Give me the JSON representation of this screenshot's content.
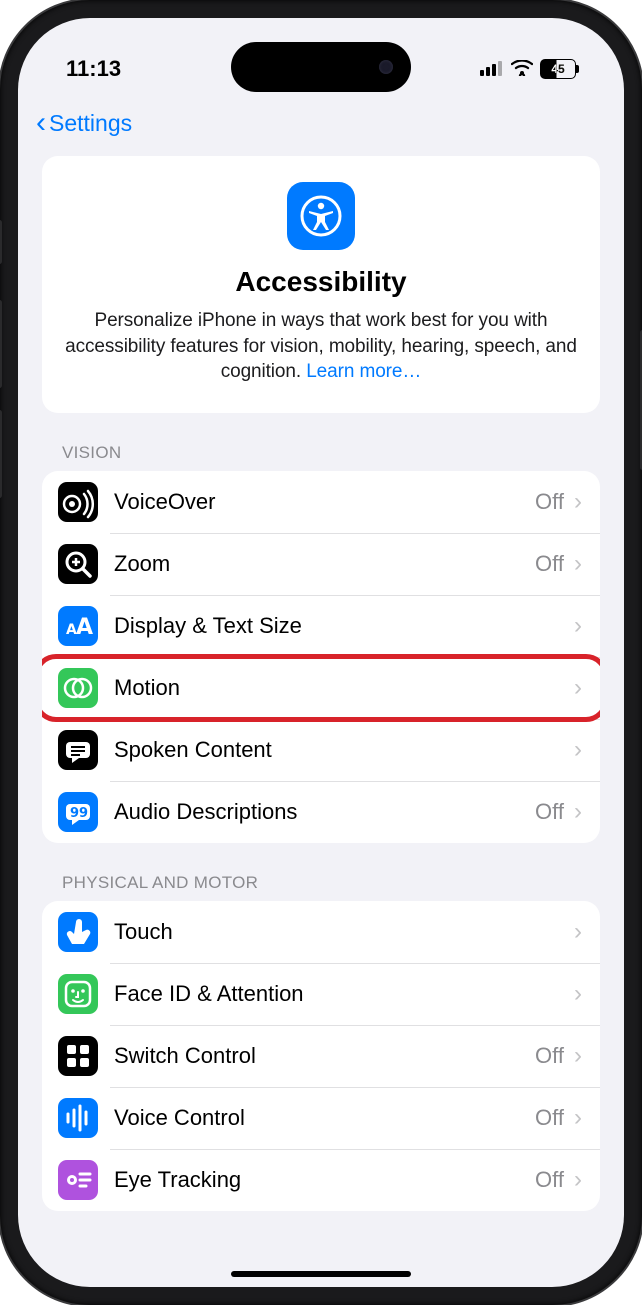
{
  "status": {
    "time": "11:13",
    "battery": "45"
  },
  "nav": {
    "back_label": "Settings"
  },
  "hero": {
    "title": "Accessibility",
    "description": "Personalize iPhone in ways that work best for you with accessibility features for vision, mobility, hearing, speech, and cognition. ",
    "link": "Learn more…"
  },
  "sections": [
    {
      "label": "VISION",
      "rows": [
        {
          "id": "voiceover",
          "label": "VoiceOver",
          "value": "Off",
          "icon_bg": "#000000",
          "icon": "voiceover"
        },
        {
          "id": "zoom",
          "label": "Zoom",
          "value": "Off",
          "icon_bg": "#000000",
          "icon": "zoom"
        },
        {
          "id": "display-text-size",
          "label": "Display & Text Size",
          "value": "",
          "icon_bg": "#007aff",
          "icon": "textsize"
        },
        {
          "id": "motion",
          "label": "Motion",
          "value": "",
          "icon_bg": "#34c759",
          "icon": "motion",
          "highlight": true
        },
        {
          "id": "spoken-content",
          "label": "Spoken Content",
          "value": "",
          "icon_bg": "#000000",
          "icon": "spoken"
        },
        {
          "id": "audio-descriptions",
          "label": "Audio Descriptions",
          "value": "Off",
          "icon_bg": "#007aff",
          "icon": "audiodesc"
        }
      ]
    },
    {
      "label": "PHYSICAL AND MOTOR",
      "rows": [
        {
          "id": "touch",
          "label": "Touch",
          "value": "",
          "icon_bg": "#007aff",
          "icon": "touch"
        },
        {
          "id": "face-id-attention",
          "label": "Face ID & Attention",
          "value": "",
          "icon_bg": "#34c759",
          "icon": "faceid"
        },
        {
          "id": "switch-control",
          "label": "Switch Control",
          "value": "Off",
          "icon_bg": "#000000",
          "icon": "switch"
        },
        {
          "id": "voice-control",
          "label": "Voice Control",
          "value": "Off",
          "icon_bg": "#007aff",
          "icon": "voicecontrol"
        },
        {
          "id": "eye-tracking",
          "label": "Eye Tracking",
          "value": "Off",
          "icon_bg": "#af52de",
          "icon": "eye"
        }
      ]
    }
  ]
}
